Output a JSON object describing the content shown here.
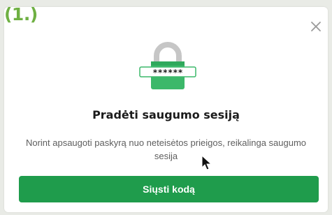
{
  "step_label": "(1.)",
  "dialog": {
    "close_icon": "close-icon",
    "illustration_icon": "padlock-password-icon",
    "password_mask": "******",
    "title": "Pradėti saugumo sesiją",
    "description": "Norint apsaugoti paskyrą nuo neteisėtos prieigos, reikalinga saugumo sesija",
    "send_button_label": "Siųsti kodą"
  },
  "colors": {
    "accent_green": "#1f9c4c",
    "lock_green": "#3cb86a",
    "step_label_green": "#6fb043"
  }
}
